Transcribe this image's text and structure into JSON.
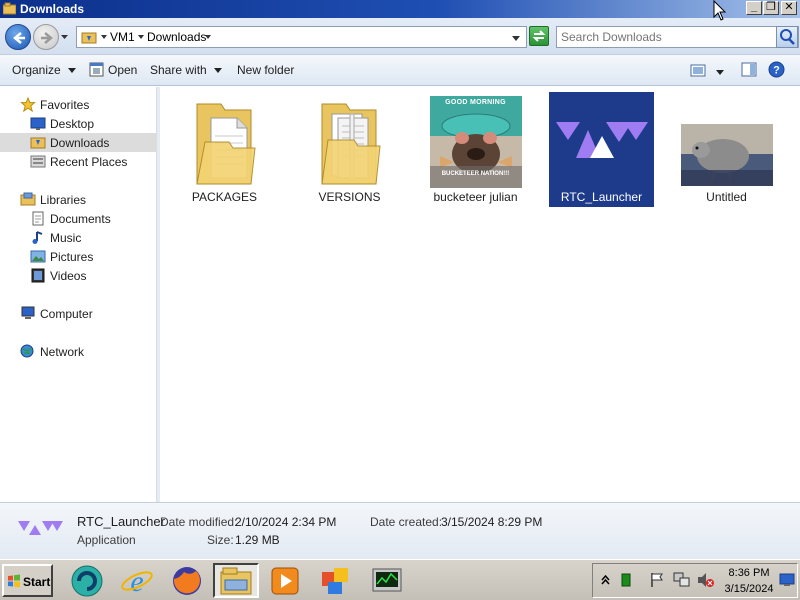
{
  "window": {
    "title": "Downloads",
    "controls": [
      "minimize",
      "restore",
      "close"
    ]
  },
  "address": {
    "crumbs": [
      "VM1",
      "Downloads"
    ],
    "search_placeholder": "Search Downloads"
  },
  "toolbar": {
    "organize": "Organize",
    "open": "Open",
    "share_with": "Share with",
    "new_folder": "New folder"
  },
  "nav": {
    "favorites": "Favorites",
    "desktop": "Desktop",
    "downloads": "Downloads",
    "recent_places": "Recent Places",
    "libraries": "Libraries",
    "documents": "Documents",
    "music": "Music",
    "pictures": "Pictures",
    "videos": "Videos",
    "computer": "Computer",
    "network": "Network"
  },
  "files": [
    {
      "name": "PACKAGES",
      "kind": "folder-icon"
    },
    {
      "name": "VERSIONS",
      "kind": "folder-icon"
    },
    {
      "name": "bucketeer julian",
      "kind": "image-thumbnail",
      "overlay_top": "GOOD MORNING",
      "overlay_bottom": "BUCKETEER NATION!!!"
    },
    {
      "name": "RTC_Launcher",
      "kind": "app-icon",
      "selected": true
    },
    {
      "name": "Untitled",
      "kind": "image-thumbnail"
    }
  ],
  "details": {
    "name": "RTC_Launcher",
    "type": "Application",
    "modified_label": "Date modified:",
    "modified_value": "2/10/2024 2:34 PM",
    "created_label": "Date created:",
    "created_value": "3/15/2024 8:29 PM",
    "size_label": "Size:",
    "size_value": "1.29 MB"
  },
  "taskbar": {
    "start": "Start",
    "apps": [
      "app-icon",
      "ie-icon",
      "firefox-icon",
      "explorer-icon",
      "media-player-icon",
      "office-icon",
      "task-manager-icon"
    ],
    "time": "8:36 PM",
    "date": "3/15/2024"
  },
  "colors": {
    "selection": "#1d3b8a",
    "accent_purple": "#a07cf2",
    "title_bar": "#1f4fb3"
  }
}
